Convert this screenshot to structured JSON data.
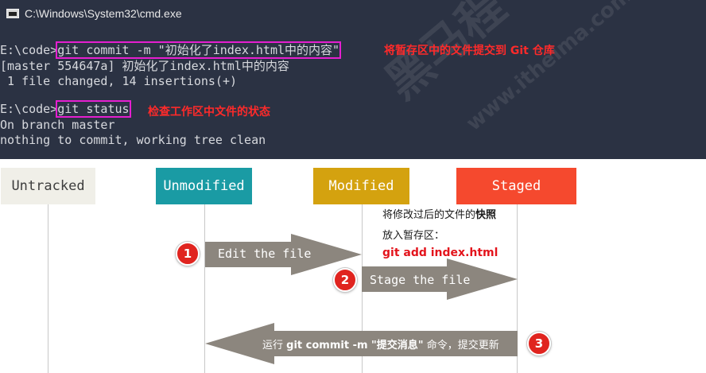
{
  "window": {
    "title": "C:\\Windows\\System32\\cmd.exe",
    "icon": "console-icon"
  },
  "terminal": {
    "line1_prompt": "E:\\code>",
    "line1_cmd": "git commit -m \"初始化了index.html中的内容\"",
    "line1_note": "将暂存区中的文件提交到 Git 仓库",
    "line2": "[master 554647a] 初始化了index.html中的内容",
    "line3": " 1 file changed, 14 insertions(+)",
    "line4_prompt": "E:\\code>",
    "line4_cmd": "git status",
    "line4_note": "检查工作区中文件的状态",
    "line5": "On branch master",
    "line6": "nothing to commit, working tree clean",
    "watermark_cn": "黑马程",
    "watermark_url": "www.itheima.com"
  },
  "states": {
    "untracked": "Untracked",
    "unmodified": "Unmodified",
    "modified": "Modified",
    "staged": "Staged",
    "colors": {
      "untracked": "#f0efe8",
      "unmodified": "#1a9ba4",
      "modified": "#d4a20f",
      "staged": "#f5492e",
      "arrow": "#8c867e",
      "badge": "#e0241f"
    }
  },
  "steps": {
    "step1": {
      "num": "1",
      "label": "Edit the file"
    },
    "step2": {
      "num": "2",
      "label": "Stage the file"
    },
    "step3": {
      "num": "3",
      "label_pre": "运行 ",
      "label_cmd": "git commit -m \"提交消息\"",
      "label_post": " 命令，提交更新"
    }
  },
  "stage_note": {
    "line1_pre": "将修改过后的文件的",
    "line1_bold": "快照",
    "line2": "放入暂存区：",
    "line3": "git add index.html"
  }
}
